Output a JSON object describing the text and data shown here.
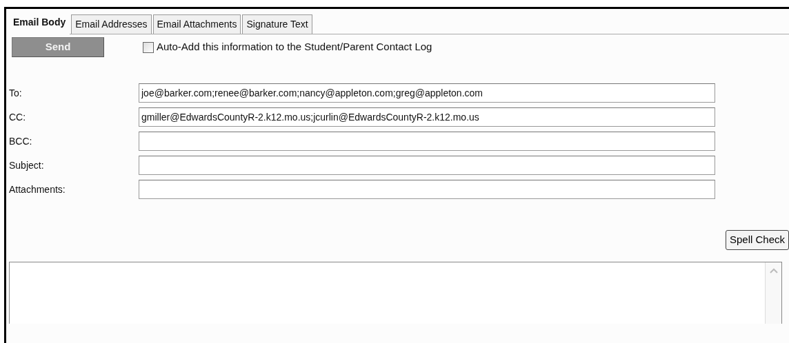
{
  "tabs": [
    {
      "label": "Email Body",
      "selected": true
    },
    {
      "label": "Email Addresses",
      "selected": false
    },
    {
      "label": "Email Attachments",
      "selected": false
    },
    {
      "label": "Signature Text",
      "selected": false
    }
  ],
  "send_button": "Send",
  "auto_add": {
    "label": "Auto-Add this information to the Student/Parent Contact Log",
    "checked": false
  },
  "fields": [
    {
      "label": "To:",
      "value": "joe@barker.com;renee@barker.com;nancy@appleton.com;greg@appleton.com"
    },
    {
      "label": "CC:",
      "value": "gmiller@EdwardsCountyR-2.k12.mo.us;jcurlin@EdwardsCountyR-2.k12.mo.us"
    },
    {
      "label": "BCC:"
    },
    {
      "label": "Subject:"
    },
    {
      "label": "Attachments:"
    }
  ],
  "spell_check_button": "Spell Check"
}
